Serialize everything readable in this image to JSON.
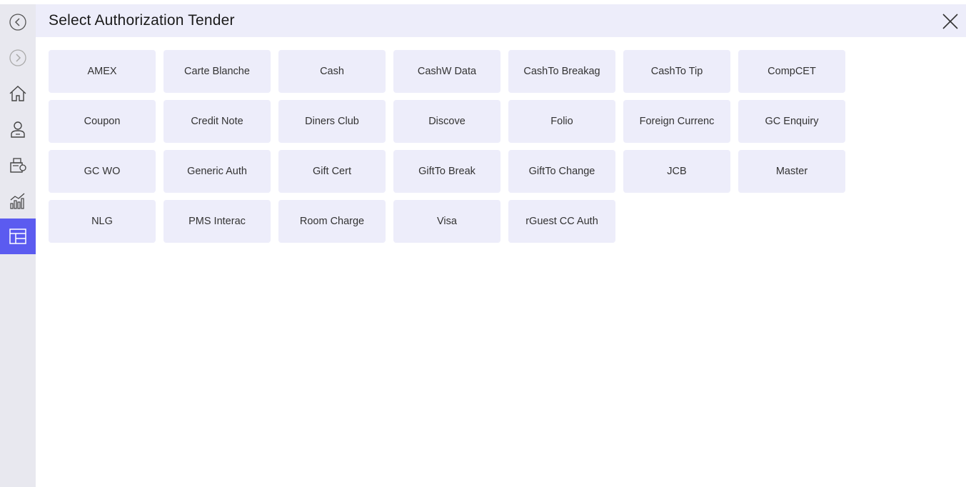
{
  "header": {
    "title": "Select Authorization Tender"
  },
  "sidebar": {
    "items": [
      {
        "icon": "back-circle-icon"
      },
      {
        "icon": "forward-circle-icon"
      },
      {
        "icon": "home-icon"
      },
      {
        "icon": "user-icon"
      },
      {
        "icon": "register-icon"
      },
      {
        "icon": "chart-icon"
      },
      {
        "icon": "layout-icon",
        "active": true
      }
    ]
  },
  "colors": {
    "accent": "#5b5bf0",
    "tile_bg": "#ededfa",
    "sidebar_bg": "#e8e8ef"
  },
  "tenders": [
    "AMEX",
    "Carte Blanche",
    "Cash",
    "CashW Data",
    "CashTo Breakag",
    "CashTo Tip",
    "CompCET",
    "Coupon",
    "Credit Note",
    "Diners Club",
    "Discove",
    "Folio",
    "Foreign Currenc",
    "GC Enquiry",
    "GC WO",
    "Generic Auth",
    "Gift Cert",
    "GiftTo Break",
    "GiftTo Change",
    "JCB",
    "Master",
    "NLG",
    "PMS Interac",
    "Room Charge",
    "Visa",
    "rGuest CC Auth"
  ]
}
